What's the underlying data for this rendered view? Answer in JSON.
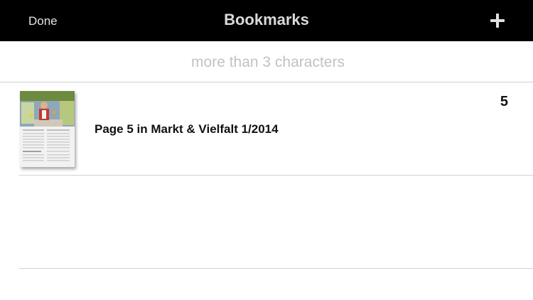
{
  "navbar": {
    "done_label": "Done",
    "title": "Bookmarks",
    "add_icon": "plus-icon"
  },
  "search": {
    "placeholder": "more than 3 characters",
    "value": ""
  },
  "bookmarks": [
    {
      "title": "Page 5 in Markt & Vielfalt 1/2014",
      "page": "5",
      "thumbnail": "magazine-page-thumbnail"
    }
  ],
  "colors": {
    "navbar_bg": "#000000",
    "title_text": "#d9d9d9",
    "placeholder": "#c2c2c2",
    "divider": "#d2d2d2"
  }
}
